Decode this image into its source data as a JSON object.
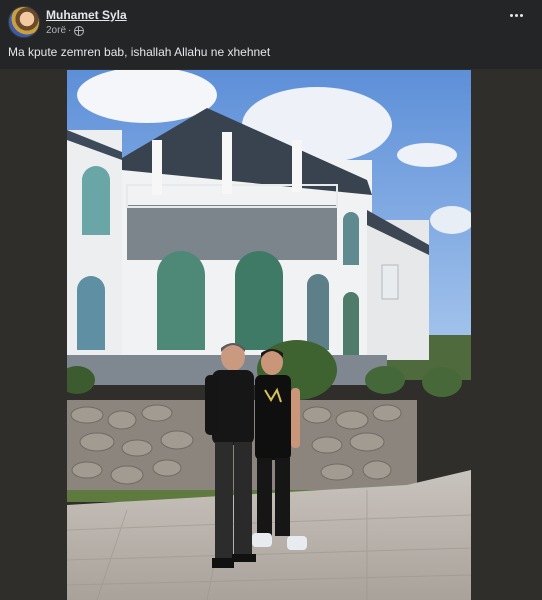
{
  "post": {
    "author": "Muhamet Syla",
    "time": "2orë",
    "separator": "·",
    "caption": "Ma kpute zemren bab, ishallah Allahu ne xhehnet",
    "privacy_icon": "globe-icon",
    "more_icon": "more-options-icon"
  },
  "photo": {
    "subject": "house-photo"
  },
  "colors": {
    "background": "#242526",
    "text": "#e4e6eb",
    "secondary_text": "#b0b3b8"
  }
}
